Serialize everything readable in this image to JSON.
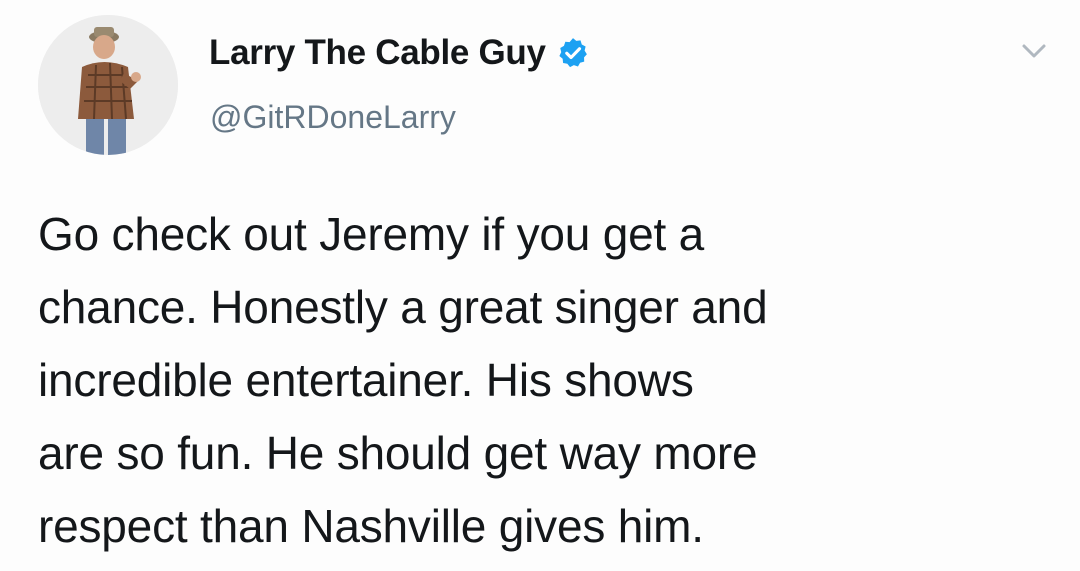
{
  "tweet": {
    "display_name": "Larry The Cable Guy",
    "handle": "@GitRDoneLarry",
    "verified": true,
    "text_lines": [
      "Go check out Jeremy if you get a",
      "chance. Honestly a great singer and",
      "incredible entertainer. His shows",
      "are so fun. He should get way more",
      "respect than Nashville gives him."
    ]
  },
  "icons": {
    "verified": "verified-badge-icon",
    "menu": "chevron-down-icon"
  },
  "colors": {
    "verified_blue": "#1da1f2",
    "handle_gray": "#657786",
    "text": "#14171a"
  }
}
